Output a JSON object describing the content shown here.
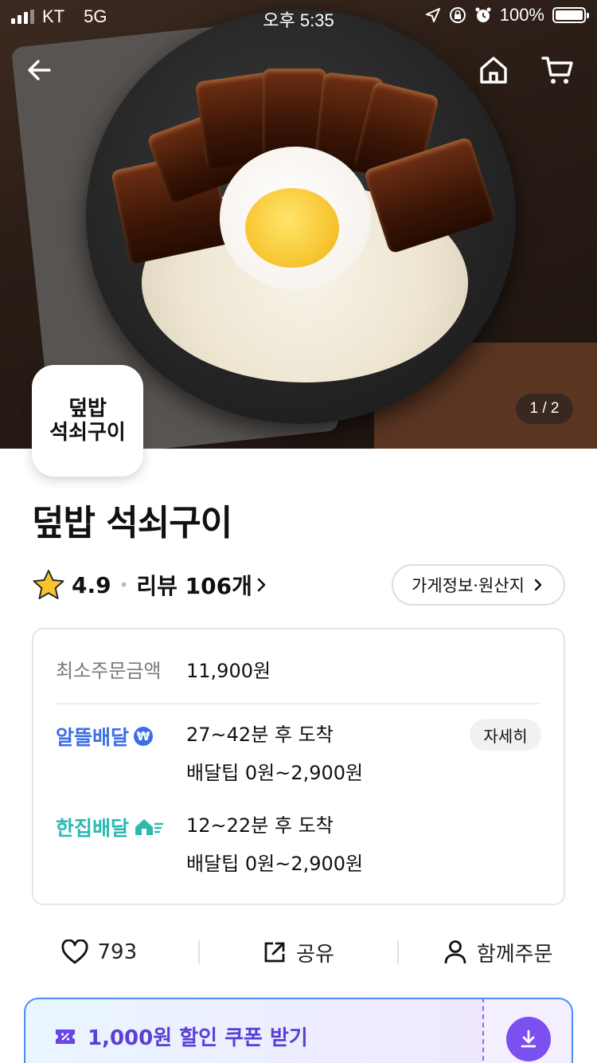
{
  "status_bar": {
    "carrier": "KT",
    "network": "5G",
    "time": "오후 5:35",
    "battery": "100%",
    "battery_level": 1.0
  },
  "hero": {
    "counter": "1 / 2"
  },
  "store": {
    "logo_line1": "덮밥",
    "logo_line2": "석쇠구이",
    "name": "덮밥 석쇠구이",
    "rating": "4.9",
    "review_label": "리뷰 106개",
    "info_button": "가게정보·원산지"
  },
  "delivery_card": {
    "min_order_label": "최소주문금액",
    "min_order_value": "11,900원",
    "economy": {
      "label": "알뜰배달",
      "time": "27~42분 후 도착",
      "tip": "배달팁 0원~2,900원",
      "detail_button": "자세히",
      "color": "#3d6ee5"
    },
    "single": {
      "label": "한집배달",
      "time": "12~22분 후 도착",
      "tip": "배달팁 0원~2,900원",
      "color": "#2cb9b2"
    }
  },
  "actions": {
    "like_count": "793",
    "share": "공유",
    "group_order": "함께주문"
  },
  "coupon": {
    "text": "1,000원 할인 쿠폰 받기",
    "accent": "#7b4ff0"
  }
}
